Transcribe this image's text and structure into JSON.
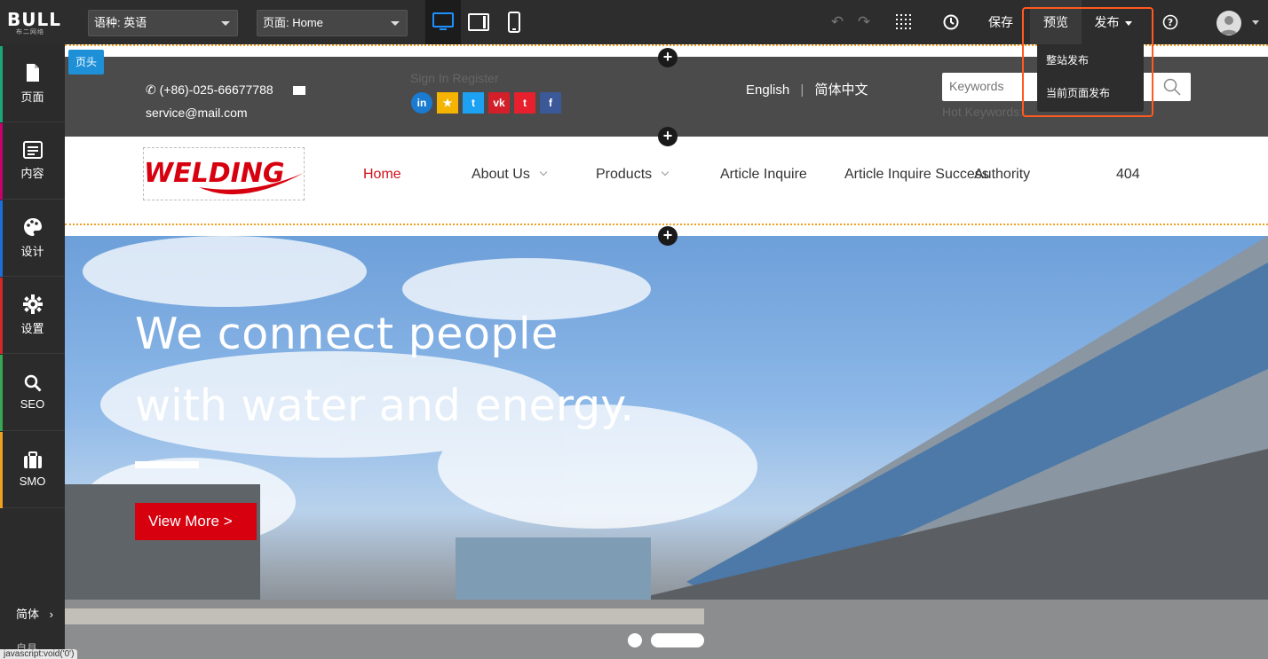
{
  "topbar": {
    "logo": "BULL",
    "logo_sub": "布二网络",
    "language_select": "语种: 英语",
    "page_select": "页面: Home",
    "save": "保存",
    "preview": "预览",
    "publish": "发布",
    "publish_menu": [
      "整站发布",
      "当前页面发布"
    ]
  },
  "sidebar": {
    "items": [
      {
        "label": "页面",
        "icon": "page-icon",
        "color": "#1aa87a"
      },
      {
        "label": "内容",
        "icon": "content-icon",
        "color": "#c8006e"
      },
      {
        "label": "设计",
        "icon": "palette-icon",
        "color": "#1c6fd8"
      },
      {
        "label": "设置",
        "icon": "gear-icon",
        "color": "#d22a2a"
      },
      {
        "label": "SEO",
        "icon": "search-icon",
        "color": "#34a853"
      },
      {
        "label": "SMO",
        "icon": "briefcase-icon",
        "color": "#f0a020"
      }
    ],
    "lang": "简体",
    "bottom": "自县"
  },
  "canvas": {
    "section_tag": "页头",
    "phone": "(+86)-025-66677788",
    "email": "service@mail.com",
    "sign": "Sign In Register",
    "lang_en": "English",
    "lang_sep": "|",
    "lang_cn": "简体中文",
    "search_placeholder": "Keywords",
    "hot_keywords": "Hot Keywords:",
    "brand": "WELDING",
    "nav": [
      "Home",
      "About Us",
      "Products",
      "Article Inquire",
      "Article Inquire Success",
      "Authority",
      "404"
    ],
    "banner_line1": "We connect people",
    "banner_line2": "with water and energy.",
    "banner_button": "View More   >"
  },
  "status_url": "javascript:void('0')",
  "colors": {
    "accent": "#d0111b",
    "highlight": "#ff5a1f",
    "tag": "#1e90d8"
  }
}
